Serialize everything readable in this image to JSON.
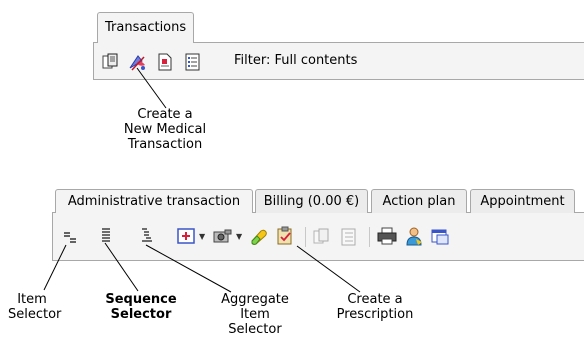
{
  "top": {
    "tab_label": "Transactions",
    "filter_text": "Filter: Full contents",
    "icons": [
      "copy-icon",
      "medical-transaction-icon",
      "document-icon",
      "list-icon"
    ]
  },
  "bottom": {
    "tabs": [
      {
        "label": "Administrative transaction",
        "active": true
      },
      {
        "label": "Billing (0.00 €)",
        "active": false
      },
      {
        "label": "Action plan",
        "active": false
      },
      {
        "label": "Appointment",
        "active": false
      }
    ],
    "icons": [
      "item-selector-icon",
      "sequence-selector-icon",
      "aggregate-item-selector-icon",
      "add-medical-icon",
      "camera-icon",
      "prescription-icon",
      "clipboard-icon",
      "copy-icon",
      "list-icon",
      "printer-icon",
      "user-icon",
      "window-icon"
    ]
  },
  "callouts": {
    "create_transaction": [
      "Create a",
      "New Medical",
      "Transaction"
    ],
    "item_selector": [
      "Item",
      "Selector"
    ],
    "sequence_selector": [
      "Sequence",
      "Selector"
    ],
    "aggregate_selector": [
      "Aggregate",
      "Item",
      "Selector"
    ],
    "create_prescription": [
      "Create a",
      "Prescription"
    ]
  },
  "colors": {
    "toolbar_bg": "#f4f4f4",
    "border": "#a8a8a8",
    "accent_red": "#d8203c",
    "accent_blue": "#3a55c8"
  }
}
